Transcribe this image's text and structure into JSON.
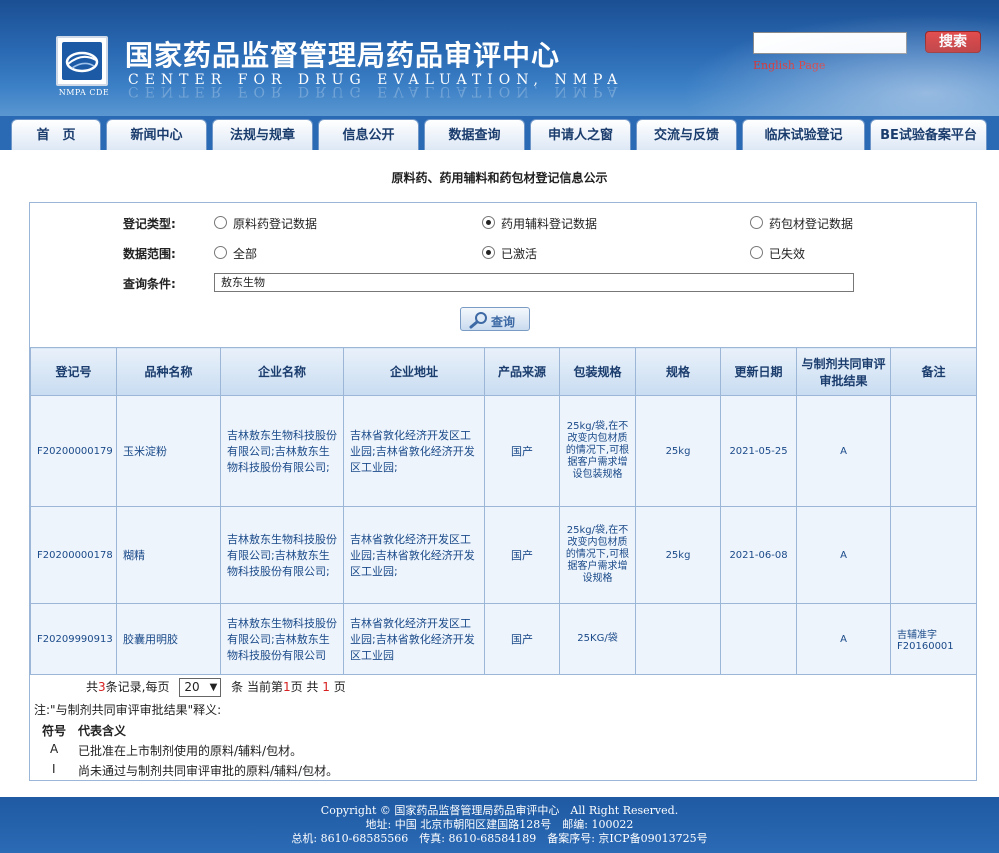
{
  "header": {
    "title": "国家药品监督管理局药品审评中心",
    "subtitle": "CENTER FOR DRUG EVALUATION, NMPA",
    "logo_text": "NMPA CDE",
    "search_button": "搜索",
    "search_placeholder": "",
    "english_link": "English Page"
  },
  "nav": {
    "tabs": [
      {
        "label": "首　页"
      },
      {
        "label": "新闻中心"
      },
      {
        "label": "法规与规章"
      },
      {
        "label": "信息公开"
      },
      {
        "label": "数据查询"
      },
      {
        "label": "申请人之窗"
      },
      {
        "label": "交流与反馈"
      },
      {
        "label": "临床试验登记"
      },
      {
        "label": "BE试验备案平台"
      }
    ]
  },
  "page_title": "原料药、药用辅料和药包材登记信息公示",
  "form": {
    "type_label": "登记类型:",
    "type_options": [
      "原料药登记数据",
      "药用辅料登记数据",
      "药包材登记数据"
    ],
    "type_selected": "药用辅料登记数据",
    "scope_label": "数据范围:",
    "scope_options": [
      "全部",
      "已激活",
      "已失效"
    ],
    "scope_selected": "已激活",
    "query_label": "查询条件:",
    "query_value": "敖东生物",
    "query_button": "查询"
  },
  "table": {
    "headers": [
      "登记号",
      "品种名称",
      "企业名称",
      "企业地址",
      "产品来源",
      "包装规格",
      "规格",
      "更新日期",
      "与制剂共同审评审批结果",
      "备注"
    ],
    "rows": [
      {
        "reg_no": "F20200000179",
        "name": "玉米淀粉",
        "company": "吉林敖东生物科技股份有限公司;吉林敖东生物科技股份有限公司;",
        "address": "吉林省敦化经济开发区工业园;吉林省敦化经济开发区工业园;",
        "source": "国产",
        "package": "25kg/袋,在不改变内包材质的情况下,可根据客户需求增设包装规格",
        "spec": "25kg",
        "date": "2021-05-25",
        "result": "A",
        "remark": ""
      },
      {
        "reg_no": "F20200000178",
        "name": "糊精",
        "company": "吉林敖东生物科技股份有限公司;吉林敖东生物科技股份有限公司;",
        "address": "吉林省敦化经济开发区工业园;吉林省敦化经济开发区工业园;",
        "source": "国产",
        "package": "25kg/袋,在不改变内包材质的情况下,可根据客户需求增设规格",
        "spec": "25kg",
        "date": "2021-06-08",
        "result": "A",
        "remark": ""
      },
      {
        "reg_no": "F20209990913",
        "name": "胶囊用明胶",
        "company": "吉林敖东生物科技股份有限公司;吉林敖东生物科技股份有限公司",
        "address": "吉林省敦化经济开发区工业园;吉林省敦化经济开发区工业园",
        "source": "国产",
        "package": "25KG/袋",
        "spec": "",
        "date": "",
        "result": "A",
        "remark": "吉辅准字F20160001"
      }
    ]
  },
  "pager": {
    "prefix": "共",
    "total": "3",
    "records_per": "条记录,每页",
    "page_size": "20",
    "current_label": "条 当前第",
    "current": "1",
    "of_label": "页 共",
    "pages": "1",
    "suffix": "页"
  },
  "notes": {
    "title": "注:\"与制剂共同审评审批结果\"释义:",
    "col_symbol": "符号",
    "col_meaning": "代表含义",
    "items": [
      {
        "symbol": "A",
        "meaning": "已批准在上市制剂使用的原料/辅料/包材。"
      },
      {
        "symbol": "I",
        "meaning": "尚未通过与制剂共同审评审批的原料/辅料/包材。"
      }
    ]
  },
  "footer": {
    "line1": "Copyright © 国家药品监督管理局药品审评中心　All Right Reserved.",
    "line2": "地址: 中国 北京市朝阳区建国路128号　邮编: 100022",
    "line3": "总机: 8610-68585566　传真: 8610-68584189　备案序号: 京ICP备09013725号"
  },
  "colors": {
    "header_blue": "#2a6ab4",
    "table_header": "#c8dcf1",
    "cell_text": "#1a4a8a",
    "accent_red": "#d72020"
  }
}
